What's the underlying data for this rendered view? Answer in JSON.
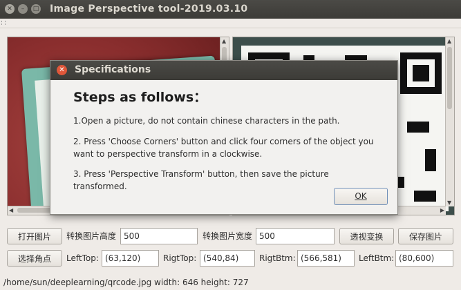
{
  "window": {
    "title": "Image Perspective tool-2019.03.10"
  },
  "controls": {
    "open_image": "打开图片",
    "height_label": "转换图片高度",
    "height_value": "500",
    "width_label": "转换图片宽度",
    "width_value": "500",
    "perspective_transform": "透视变换",
    "save_image": "保存图片",
    "choose_corners": "选择角点",
    "left_top_label": "LeftTop:",
    "left_top_value": "(63,120)",
    "right_top_label": "RigtTop:",
    "right_top_value": "(540,84)",
    "right_bottom_label": "RigtBtm:",
    "right_bottom_value": "(566,581)",
    "left_bottom_label": "LeftBtm:",
    "left_bottom_value": "(80,600)"
  },
  "status_bar": {
    "text": "/home/sun/deeplearning/qrcode.jpg width: 646 height: 727"
  },
  "dialog": {
    "title": "Specifications",
    "heading": "Steps as follows：",
    "step1": "1.Open a picture, do not contain chinese characters in the path.",
    "step2": "2. Press 'Choose Corners' button and click four corners of the object you want to perspective transform in a clockwise.",
    "step3": "3. Press 'Perspective Transform' button, then save the picture transformed.",
    "ok": "OK"
  },
  "icons": {
    "window_close": "close-icon",
    "window_minimize": "minimize-icon",
    "window_maximize": "maximize-icon",
    "dialog_close": "close-icon"
  }
}
